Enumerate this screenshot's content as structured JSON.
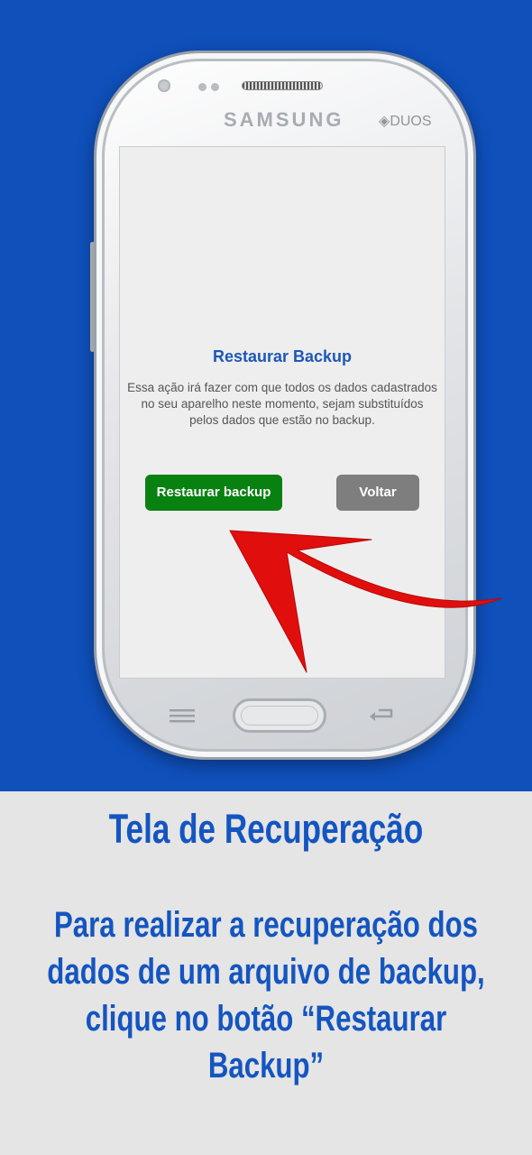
{
  "device": {
    "brand": "SAMSUNG",
    "model_badge": "DUOS"
  },
  "dialog": {
    "title": "Restaurar Backup",
    "message": "Essa ação irá fazer com que todos os dados cadastrados no seu aparelho neste momento, sejam substituídos pelos dados que estão no backup.",
    "restore_button": "Restaurar backup",
    "back_button": "Voltar"
  },
  "caption": {
    "title": "Tela de Recuperação",
    "body": "Para realizar a recuperação dos dados de um arquivo de backup, clique no botão “Restaurar Backup”"
  },
  "colors": {
    "top_background": "#0f50bb",
    "bottom_background": "#e5e5e5",
    "caption_text": "#1455c0",
    "restore_button": "#088111",
    "back_button": "#7e7e7e",
    "arrow": "#e10e0e"
  }
}
